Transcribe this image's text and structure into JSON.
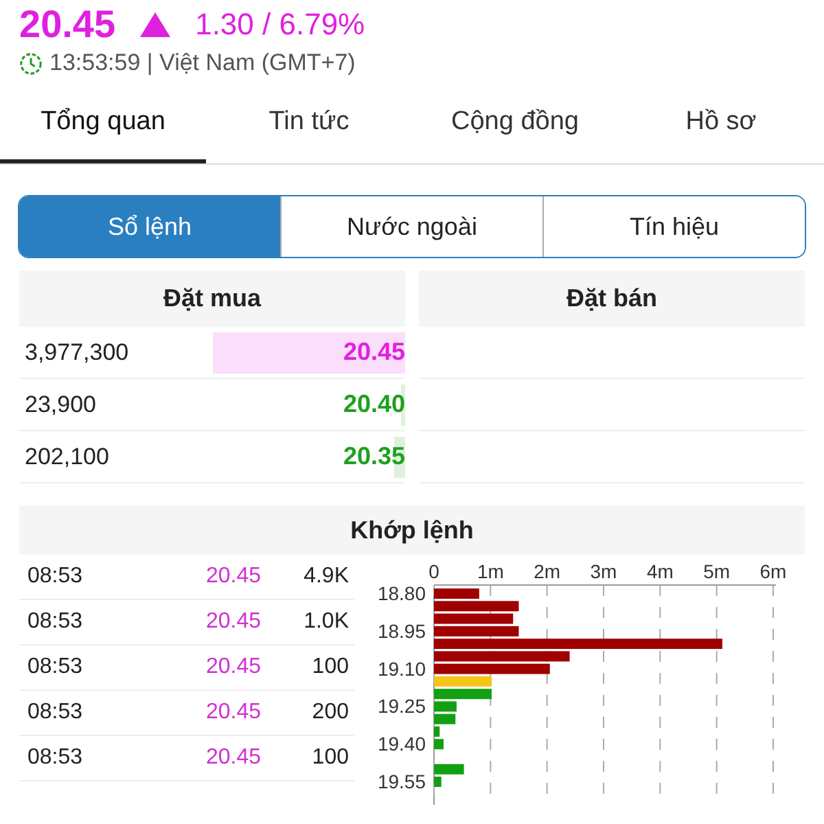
{
  "quote": {
    "price": "20.45",
    "change": "1.30 / 6.79%",
    "time": "13:53:59 | Việt Nam (GMT+7)"
  },
  "tabs": [
    {
      "label": "Tổng quan",
      "selected": true
    },
    {
      "label": "Tin tức",
      "selected": false
    },
    {
      "label": "Cộng đồng",
      "selected": false
    },
    {
      "label": "Hồ sơ",
      "selected": false
    }
  ],
  "segments": [
    {
      "label": "Sổ lệnh",
      "selected": true
    },
    {
      "label": "Nước ngoài",
      "selected": false
    },
    {
      "label": "Tín hiệu",
      "selected": false
    }
  ],
  "order_book": {
    "columns": [
      "Đặt mua",
      "Đặt bán"
    ],
    "bids": [
      {
        "volume": "3,977,300",
        "price": "20.45",
        "color": "#e020e0",
        "level": 0.5
      },
      {
        "volume": "23,900",
        "price": "20.40",
        "color": "#20a020",
        "level": 0.01
      },
      {
        "volume": "202,100",
        "price": "20.35",
        "color": "#20a020",
        "level": 0.03
      }
    ]
  },
  "matched": {
    "title": "Khớp lệnh",
    "trades": [
      {
        "time": "08:53",
        "price": "20.45",
        "volume": "4.9K"
      },
      {
        "time": "08:53",
        "price": "20.45",
        "volume": "1.0K"
      },
      {
        "time": "08:53",
        "price": "20.45",
        "volume": "100"
      },
      {
        "time": "08:53",
        "price": "20.45",
        "volume": "200"
      },
      {
        "time": "08:53",
        "price": "20.45",
        "volume": "100"
      }
    ],
    "chart_data": {
      "type": "bar",
      "orientation": "horizontal",
      "grid": true,
      "x": [
        18.8,
        18.85,
        18.9,
        18.95,
        19.0,
        19.05,
        19.1,
        19.15,
        19.2,
        19.25,
        19.3,
        19.35,
        19.4,
        19.45,
        19.5,
        19.55
      ],
      "series": [
        {
          "color": "#a00000",
          "values": [
            0.8,
            1.5,
            1.4,
            1.5,
            5.1,
            2.4,
            2.05,
            null,
            null,
            null,
            null,
            null,
            null,
            null,
            null,
            null
          ]
        },
        {
          "color": "#f5c518",
          "values": [
            null,
            null,
            null,
            null,
            null,
            null,
            null,
            1.02,
            null,
            null,
            null,
            null,
            null,
            null,
            null,
            null
          ]
        },
        {
          "color": "#12a012",
          "values": [
            null,
            null,
            null,
            null,
            null,
            null,
            null,
            null,
            1.02,
            0.4,
            0.38,
            0.1,
            0.17,
            0,
            0.53,
            0.13
          ]
        }
      ],
      "xlim": [
        0,
        6
      ],
      "ylim": [
        19.55,
        18.8
      ],
      "xticks": [
        {
          "value": 0,
          "label": "0"
        },
        {
          "value": 1,
          "label": "1m"
        },
        {
          "value": 2,
          "label": "2m"
        },
        {
          "value": 3,
          "label": "3m"
        },
        {
          "value": 4,
          "label": "4m"
        },
        {
          "value": 5,
          "label": "5m"
        },
        {
          "value": 6,
          "label": "6m"
        }
      ],
      "yticks": [
        {
          "value": 18.8,
          "label": "18.80"
        },
        {
          "value": 18.95,
          "label": "18.95"
        },
        {
          "value": 19.1,
          "label": "19.10"
        },
        {
          "value": 19.25,
          "label": "19.25"
        },
        {
          "value": 19.4,
          "label": "19.40"
        },
        {
          "value": 19.55,
          "label": "19.55"
        }
      ]
    }
  }
}
